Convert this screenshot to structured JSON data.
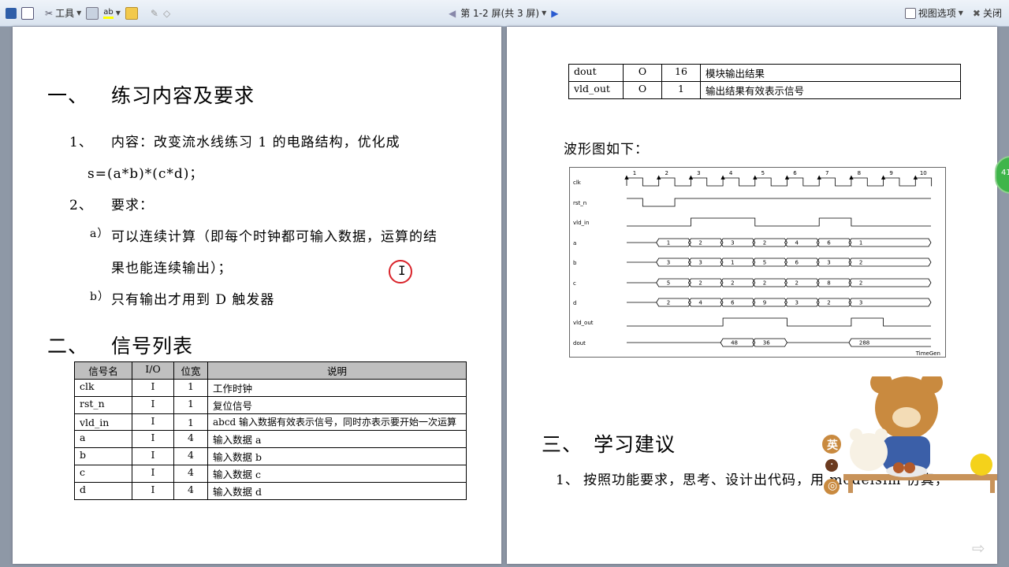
{
  "toolbar": {
    "tools_label": "工具",
    "page_indicator": "第 1-2 屏(共 3 屏)",
    "view_options_label": "视图选项",
    "close_label": "关闭"
  },
  "left_page": {
    "section1_num": "一、",
    "section1_title": "练习内容及要求",
    "item1_num": "1、",
    "item1_text": "内容：改变流水线练习 1 的电路结构，优化成",
    "item1_formula": "s=(a*b)*(c*d)；",
    "item2_num": "2、",
    "item2_text": "要求：",
    "sub_a_label": "a）",
    "sub_a_line1": "可以连续计算（即每个时钟都可输入数据，运算的结",
    "sub_a_line2": "果也能连续输出）；",
    "sub_b_label": "b）",
    "sub_b_text": "只有输出才用到 D 触发器",
    "cursor_glyph": "I",
    "section2_num": "二、",
    "section2_title": "信号列表",
    "table_headers": [
      "信号名",
      "I/O",
      "位宽",
      "说明"
    ],
    "table_rows": [
      [
        "clk",
        "I",
        "1",
        "工作时钟"
      ],
      [
        "rst_n",
        "I",
        "1",
        "复位信号"
      ],
      [
        "vld_in",
        "I",
        "1",
        "abcd 输入数据有效表示信号，同时亦表示要开始一次运算"
      ],
      [
        "a",
        "I",
        "4",
        "输入数据 a"
      ],
      [
        "b",
        "I",
        "4",
        "输入数据 b"
      ],
      [
        "c",
        "I",
        "4",
        "输入数据 c"
      ],
      [
        "d",
        "I",
        "4",
        "输入数据 d"
      ]
    ]
  },
  "right_page": {
    "table_rows": [
      [
        "dout",
        "O",
        "16",
        "模块输出结果"
      ],
      [
        "vld_out",
        "O",
        "1",
        "输出结果有效表示信号"
      ]
    ],
    "waveform_caption": "波形图如下：",
    "waveform": {
      "cycle_numbers": [
        "1",
        "2",
        "3",
        "4",
        "5",
        "6",
        "7",
        "8",
        "9",
        "10"
      ],
      "signals": [
        "clk",
        "rst_n",
        "vld_in",
        "a",
        "b",
        "c",
        "d",
        "vld_out",
        "dout"
      ],
      "a_values": [
        "1",
        "2",
        "3",
        "2",
        "4",
        "6",
        "1"
      ],
      "b_values": [
        "3",
        "3",
        "1",
        "5",
        "6",
        "3",
        "2"
      ],
      "c_values": [
        "5",
        "2",
        "2",
        "2",
        "2",
        "8",
        "2"
      ],
      "d_values": [
        "2",
        "4",
        "6",
        "9",
        "3",
        "2",
        "3"
      ],
      "dout_values": [
        "48",
        "36",
        "288"
      ],
      "footer": "TimeGen"
    },
    "section3_num": "三、",
    "section3_title": "学习建议",
    "item1_num": "1、",
    "item1_text": "按照功能要求，思考、设计出代码，用 modelsim 仿真，",
    "badge_text": "41",
    "sticker_glyphs": [
      "英",
      "·",
      "◎"
    ]
  }
}
